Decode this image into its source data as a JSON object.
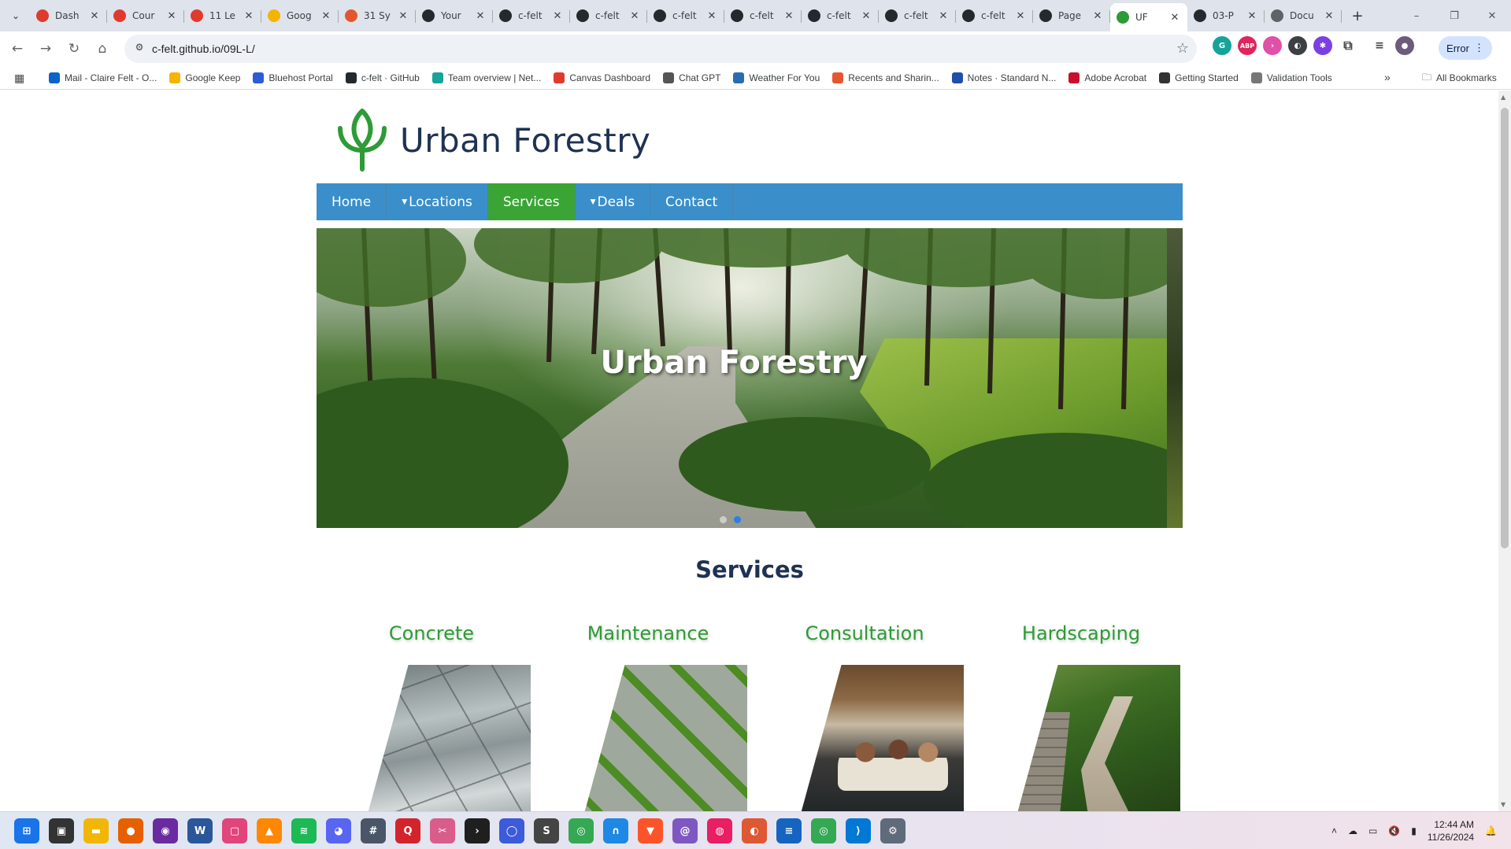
{
  "browser": {
    "tabs": [
      {
        "title": "Dash",
        "icon": "canvas-icon",
        "color": "#e03a2f"
      },
      {
        "title": "Cour",
        "icon": "canvas-icon",
        "color": "#e03a2f"
      },
      {
        "title": "11 Le",
        "icon": "canvas-icon",
        "color": "#e03a2f"
      },
      {
        "title": "Goog",
        "icon": "google-keep-icon",
        "color": "#f4b400"
      },
      {
        "title": "31 Sy",
        "icon": "tab-app-icon",
        "color": "#e4572e"
      },
      {
        "title": "Your",
        "icon": "github-icon",
        "color": "#24292e"
      },
      {
        "title": "c-felt",
        "icon": "github-icon",
        "color": "#24292e"
      },
      {
        "title": "c-felt",
        "icon": "github-icon",
        "color": "#24292e"
      },
      {
        "title": "c-felt",
        "icon": "github-icon",
        "color": "#24292e"
      },
      {
        "title": "c-felt",
        "icon": "github-icon",
        "color": "#24292e"
      },
      {
        "title": "c-felt",
        "icon": "github-icon",
        "color": "#24292e"
      },
      {
        "title": "c-felt",
        "icon": "github-icon",
        "color": "#24292e"
      },
      {
        "title": "c-felt",
        "icon": "github-icon",
        "color": "#24292e"
      },
      {
        "title": "Page",
        "icon": "github-icon",
        "color": "#24292e"
      },
      {
        "title": "UF",
        "icon": "leaf-icon",
        "color": "#2e9b36",
        "active": true
      },
      {
        "title": "03-P",
        "icon": "github-icon",
        "color": "#24292e"
      },
      {
        "title": "Docu",
        "icon": "globe-icon",
        "color": "#5f6368"
      }
    ],
    "new_tab_symbol": "+",
    "window_controls": {
      "minimize": "–",
      "restore": "❐",
      "close": "✕"
    },
    "address": "c-felt.github.io/09L-L/",
    "profile_status": "Error",
    "bookmarks": [
      {
        "label": "Mail - Claire Felt - O...",
        "color": "#0a64c8"
      },
      {
        "label": "Google Keep",
        "color": "#f4b400"
      },
      {
        "label": "Bluehost Portal",
        "color": "#2e5bd8"
      },
      {
        "label": "c-felt · GitHub",
        "color": "#24292e"
      },
      {
        "label": "Team overview | Net...",
        "color": "#15a39a"
      },
      {
        "label": "Canvas Dashboard",
        "color": "#e03a2f"
      },
      {
        "label": "Chat GPT",
        "color": "#555555"
      },
      {
        "label": "Weather For You",
        "color": "#2b6cb0"
      },
      {
        "label": "Recents and Sharin...",
        "color": "#e4572e"
      },
      {
        "label": "Notes · Standard N...",
        "color": "#1f4fa8"
      },
      {
        "label": "Adobe Acrobat",
        "color": "#c8102e"
      },
      {
        "label": "Getting Started",
        "color": "#333333"
      },
      {
        "label": "Validation Tools",
        "color": "#777777"
      }
    ],
    "bookmarks_more": "»",
    "all_bookmarks": "All Bookmarks"
  },
  "page": {
    "brand": "Urban Forestry",
    "nav": [
      {
        "label": "Home",
        "caret": ""
      },
      {
        "label": "Locations",
        "caret": "▼"
      },
      {
        "label": "Services",
        "caret": "",
        "active": true
      },
      {
        "label": "Deals",
        "caret": "▼"
      },
      {
        "label": "Contact",
        "caret": ""
      }
    ],
    "hero_title": "Urban Forestry",
    "services_heading": "Services",
    "services": [
      {
        "label": "Concrete",
        "image": "concrete"
      },
      {
        "label": "Maintenance",
        "image": "maint"
      },
      {
        "label": "Consultation",
        "image": "consult"
      },
      {
        "label": "Hardscaping",
        "image": "hard"
      }
    ],
    "colors": {
      "nav": "#3a8fca",
      "nav_active": "#3aa534",
      "heading": "#1e3252",
      "service_label": "#2e9b36"
    }
  },
  "taskbar": {
    "apps": [
      {
        "name": "start-icon",
        "color": "#1a73e8",
        "glyph": "⊞"
      },
      {
        "name": "task-view-icon",
        "color": "#333333",
        "glyph": "▣"
      },
      {
        "name": "file-explorer-icon",
        "color": "#f2b705",
        "glyph": "▬"
      },
      {
        "name": "firefox-icon",
        "color": "#e66000",
        "glyph": "●"
      },
      {
        "name": "app-icon-purple",
        "color": "#6a2ba0",
        "glyph": "◉"
      },
      {
        "name": "word-icon",
        "color": "#2b579a",
        "glyph": "W"
      },
      {
        "name": "app-icon-pink",
        "color": "#e0457b",
        "glyph": "▢"
      },
      {
        "name": "vlc-icon",
        "color": "#ff8800",
        "glyph": "▲"
      },
      {
        "name": "spotify-icon",
        "color": "#1db954",
        "glyph": "≋"
      },
      {
        "name": "discord-icon",
        "color": "#5865f2",
        "glyph": "◕"
      },
      {
        "name": "calculator-icon",
        "color": "#4a5568",
        "glyph": "#"
      },
      {
        "name": "app-icon-red",
        "color": "#d4242b",
        "glyph": "Q"
      },
      {
        "name": "snipping-tool-icon",
        "color": "#d95d8a",
        "glyph": "✂"
      },
      {
        "name": "plex-icon",
        "color": "#1f1f1f",
        "glyph": "›"
      },
      {
        "name": "app-icon-blue",
        "color": "#3b5bdb",
        "glyph": "◯"
      },
      {
        "name": "app-icon-s",
        "color": "#444444",
        "glyph": "S"
      },
      {
        "name": "chrome-icon",
        "color": "#34a853",
        "glyph": "◎"
      },
      {
        "name": "app-icon-arc",
        "color": "#1e88e5",
        "glyph": "∩"
      },
      {
        "name": "brave-icon",
        "color": "#fb542b",
        "glyph": "▼"
      },
      {
        "name": "app-icon-swirl",
        "color": "#7e57c2",
        "glyph": "@"
      },
      {
        "name": "app-icon-orb",
        "color": "#e91e63",
        "glyph": "◍"
      },
      {
        "name": "duckduckgo-icon",
        "color": "#de5833",
        "glyph": "◐"
      },
      {
        "name": "notepad-icon",
        "color": "#1565c0",
        "glyph": "≡"
      },
      {
        "name": "chrome-profile-icon",
        "color": "#34a853",
        "glyph": "◎"
      },
      {
        "name": "vscode-icon",
        "color": "#0078d4",
        "glyph": "⟩"
      },
      {
        "name": "settings-icon",
        "color": "#5f6b7a",
        "glyph": "⚙"
      }
    ],
    "time": "12:44 AM",
    "date": "11/26/2024"
  }
}
